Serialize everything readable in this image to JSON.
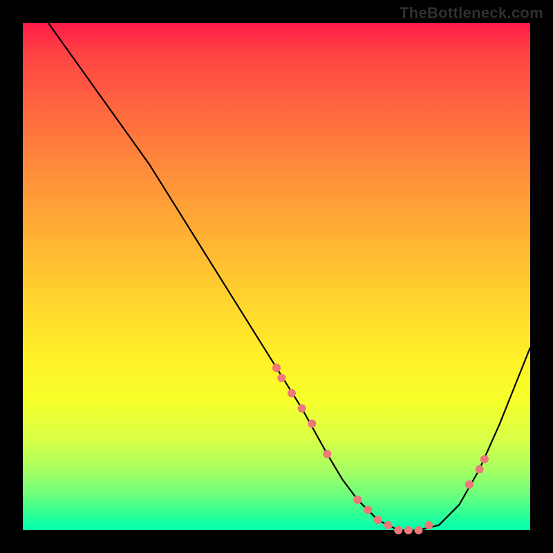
{
  "watermark": "TheBottleneck.com",
  "chart_data": {
    "type": "line",
    "title": "",
    "xlabel": "",
    "ylabel": "",
    "xlim": [
      0,
      100
    ],
    "ylim": [
      0,
      100
    ],
    "x": [
      5,
      10,
      15,
      20,
      25,
      30,
      35,
      40,
      45,
      50,
      55,
      60,
      63,
      66,
      70,
      74,
      78,
      82,
      86,
      90,
      94,
      98,
      100
    ],
    "values": [
      100,
      93,
      86,
      79,
      72,
      64,
      56,
      48,
      40,
      32,
      24,
      15,
      10,
      6,
      2,
      0,
      0,
      1,
      5,
      12,
      21,
      31,
      36
    ],
    "markers": {
      "x": [
        50,
        51,
        53,
        55,
        57,
        60,
        66,
        68,
        70,
        72,
        74,
        76,
        78,
        80,
        88,
        90,
        91
      ],
      "values": [
        32,
        30,
        27,
        24,
        21,
        15,
        6,
        4,
        2,
        1,
        0,
        0,
        0,
        1,
        9,
        12,
        14
      ]
    },
    "curve_color": "#000000",
    "marker_color": "#ec7878",
    "background_gradient": [
      "#ff1a47",
      "#fff028",
      "#00ffad"
    ]
  }
}
